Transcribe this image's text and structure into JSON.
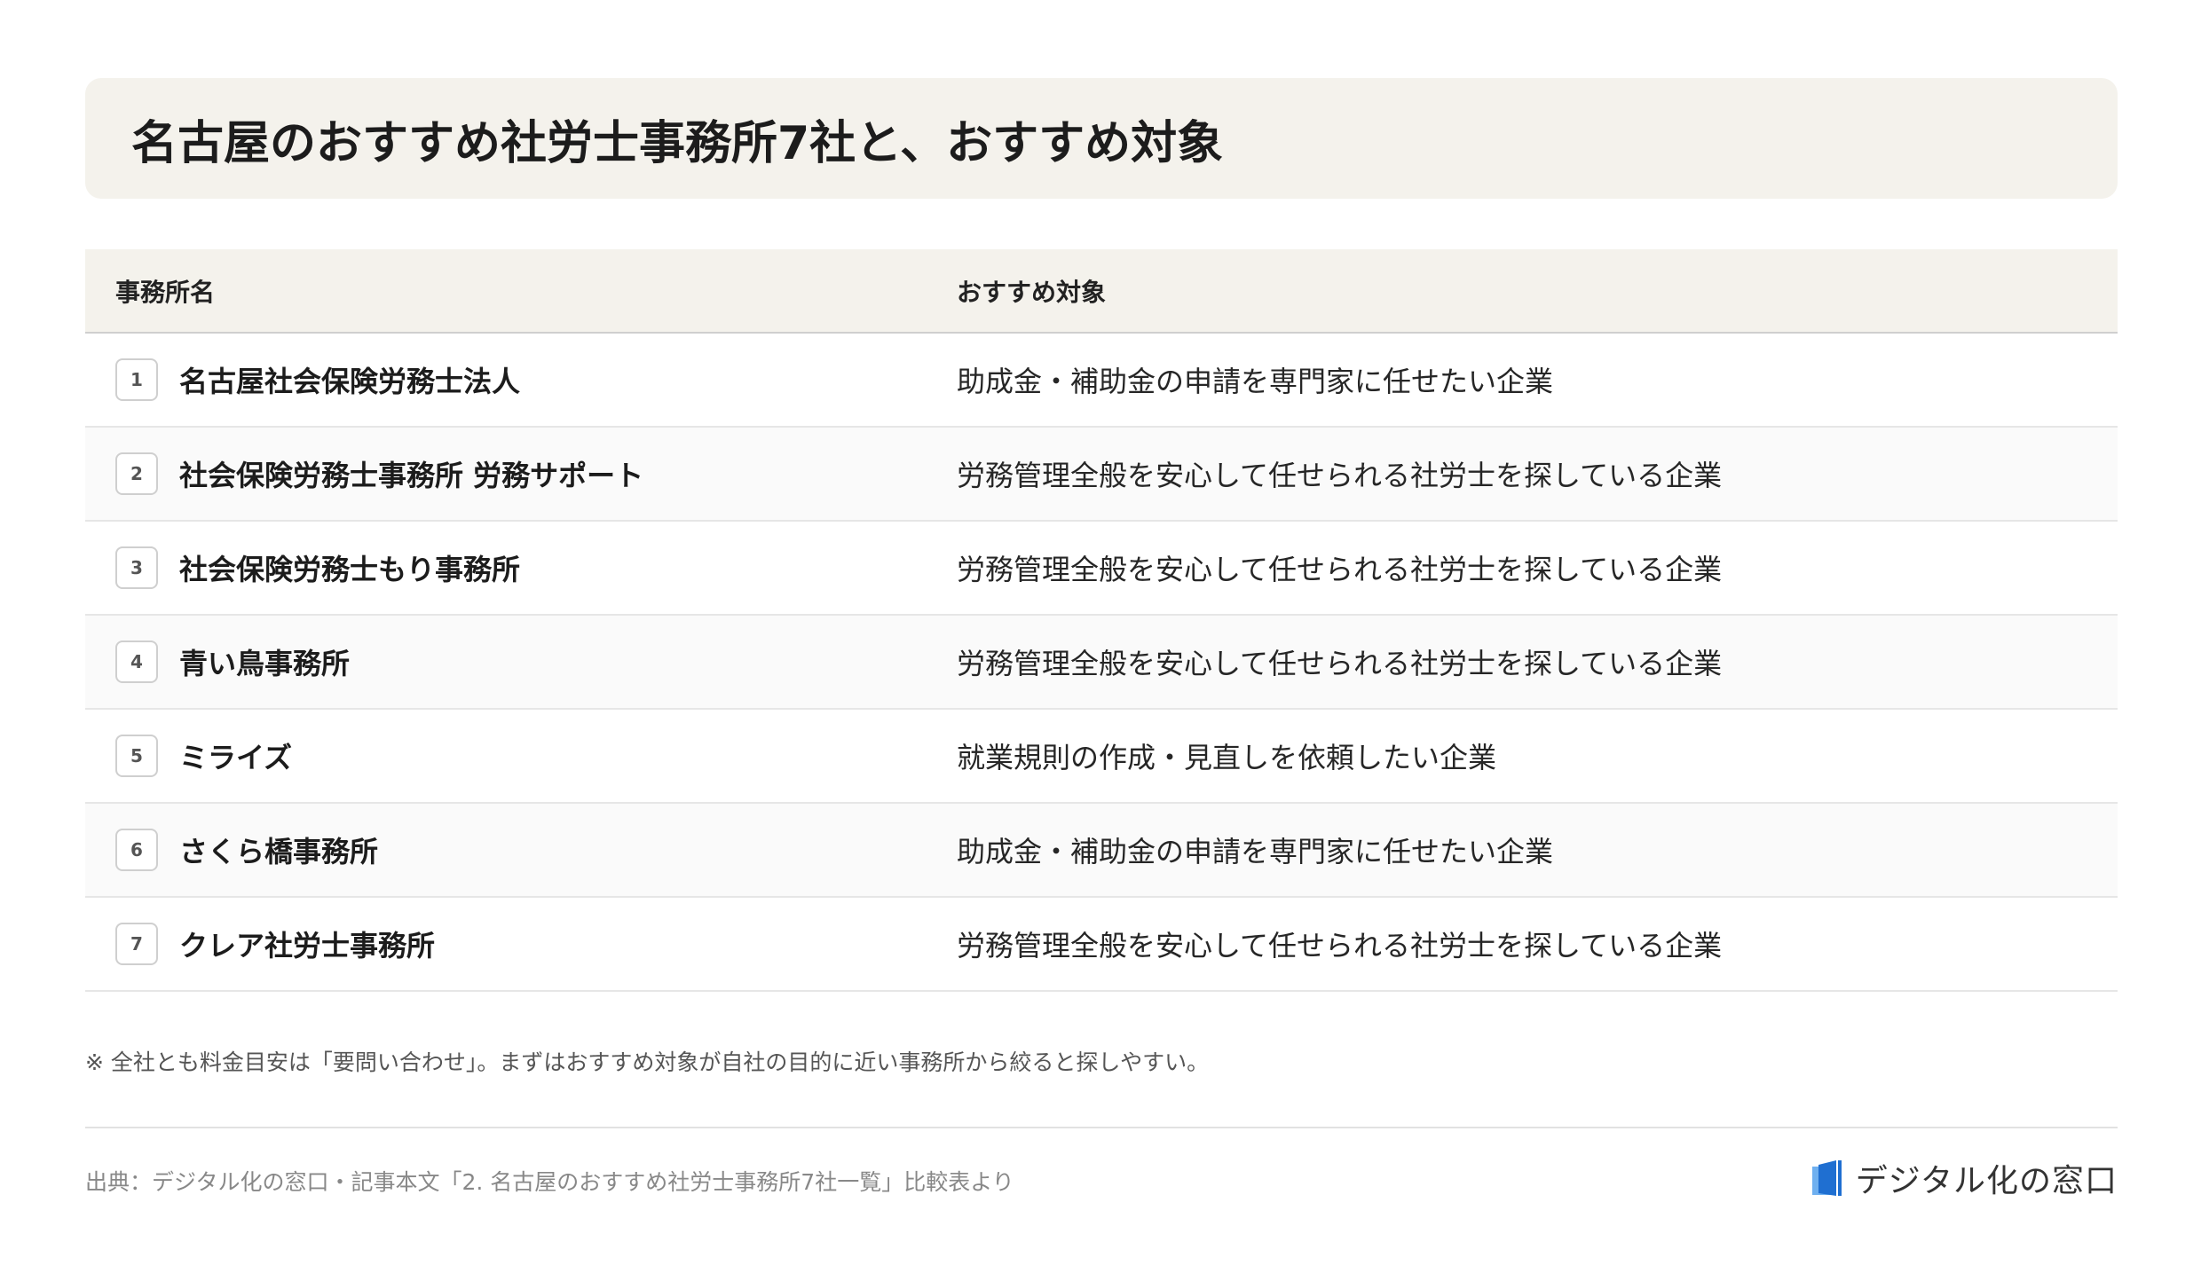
{
  "title": "名古屋のおすすめ社労士事務所7社と、おすすめ対象",
  "table": {
    "headers": {
      "name": "事務所名",
      "target": "おすすめ対象"
    },
    "rows": [
      {
        "num": "1",
        "name": "名古屋社会保険労務士法人",
        "target": "助成金・補助金の申請を専門家に任せたい企業"
      },
      {
        "num": "2",
        "name": "社会保険労務士事務所 労務サポート",
        "target": "労務管理全般を安心して任せられる社労士を探している企業"
      },
      {
        "num": "3",
        "name": "社会保険労務士もり事務所",
        "target": "労務管理全般を安心して任せられる社労士を探している企業"
      },
      {
        "num": "4",
        "name": "青い鳥事務所",
        "target": "労務管理全般を安心して任せられる社労士を探している企業"
      },
      {
        "num": "5",
        "name": "ミライズ",
        "target": "就業規則の作成・見直しを依頼したい企業"
      },
      {
        "num": "6",
        "name": "さくら橋事務所",
        "target": "助成金・補助金の申請を専門家に任せたい企業"
      },
      {
        "num": "7",
        "name": "クレア社労士事務所",
        "target": "労務管理全般を安心して任せられる社労士を探している企業"
      }
    ]
  },
  "note": "※ 全社とも料金目安は「要問い合わせ」。まずはおすすめ対象が自社の目的に近い事務所から絞ると探しやすい。",
  "source": "出典：デジタル化の窓口・記事本文「2. 名古屋のおすすめ社労士事務所7社一覧」比較表より",
  "brand": {
    "name": "デジタル化の窓口",
    "icon": "door-logo-icon",
    "color_primary": "#1f6fd1",
    "color_light": "#6fb0f0"
  }
}
